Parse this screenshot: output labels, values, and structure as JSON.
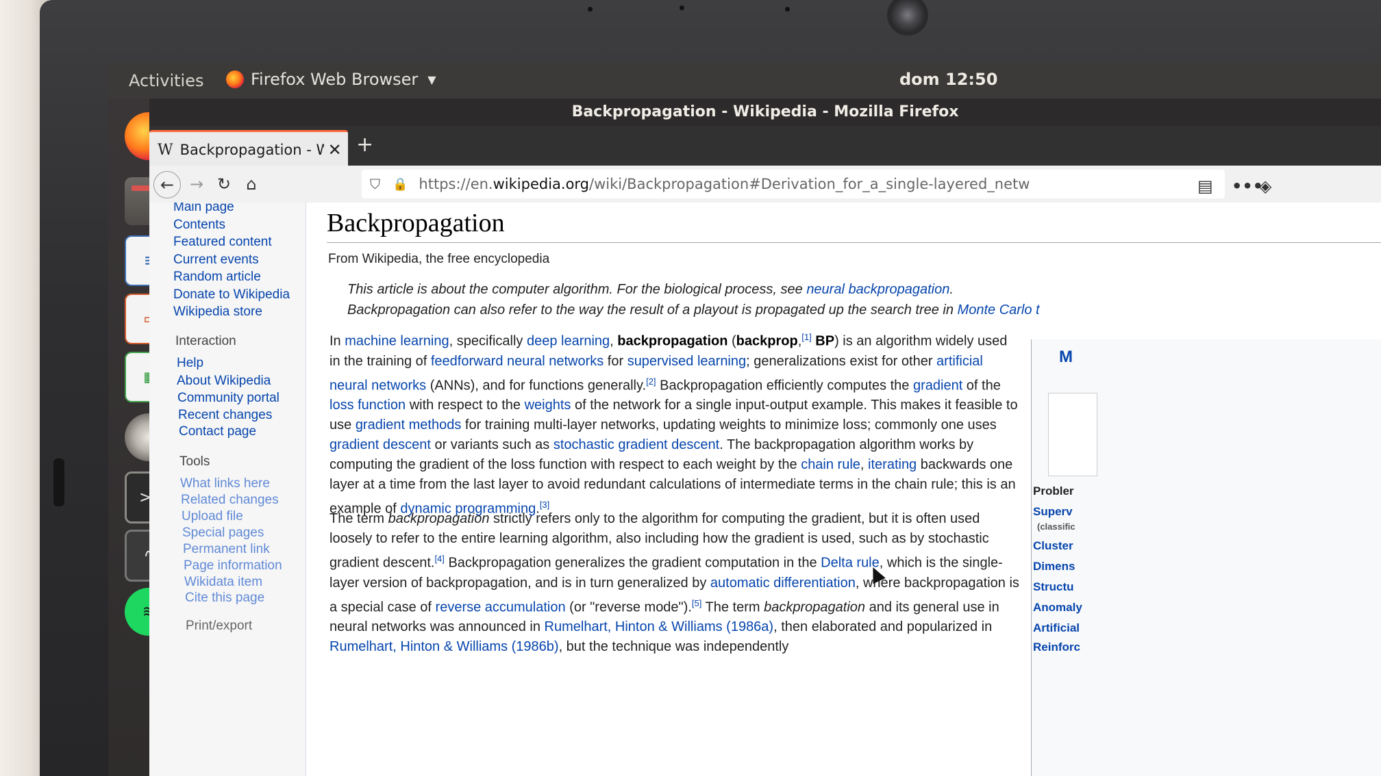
{
  "topbar": {
    "activities": "Activities",
    "app_menu": "Firefox Web Browser",
    "clock": "dom 12:50"
  },
  "window": {
    "title": "Backpropagation - Wikipedia - Mozilla Firefox"
  },
  "tab": {
    "favicon": "W",
    "title": "Backpropagation - Wikip",
    "close": "✕",
    "new_tab": "+"
  },
  "navbar": {
    "back": "←",
    "forward": "→",
    "reload": "↻",
    "home": "⌂",
    "url_scheme": "https://en.",
    "url_host": "wikipedia.org",
    "url_path": "/wiki/Backpropagation#Derivation_for_a_single-layered_netw",
    "reader": "▤",
    "more": "•••",
    "pocket": "◈"
  },
  "sidebar": {
    "nav": [
      "Main page",
      "Contents",
      "Featured content",
      "Current events",
      "Random article",
      "Donate to Wikipedia",
      "Wikipedia store"
    ],
    "interaction_heading": "Interaction",
    "interaction": [
      "Help",
      "About Wikipedia",
      "Community portal",
      "Recent changes",
      "Contact page"
    ],
    "tools_heading": "Tools",
    "tools": [
      "What links here",
      "Related changes",
      "Upload file",
      "Special pages",
      "Permanent link",
      "Page information",
      "Wikidata item",
      "Cite this page"
    ],
    "print_heading": "Print/export"
  },
  "article": {
    "title": "Backpropagation",
    "tagline": "From Wikipedia, the free encyclopedia",
    "hatnote1_text": "This article is about the computer algorithm. For the biological process, see ",
    "hatnote1_link": "neural backpropagation",
    "hatnote2_text": "Backpropagation can also refer to the way the result of a playout is propagated up the search tree in ",
    "hatnote2_link": "Monte Carlo t"
  },
  "infobox": {
    "title": "M",
    "heading": "Probler",
    "items": [
      "Superv",
      "Cluster",
      "Dimens",
      "Structu",
      "Anomaly",
      "Artificial",
      "Reinforc"
    ],
    "sub": "(classific"
  }
}
